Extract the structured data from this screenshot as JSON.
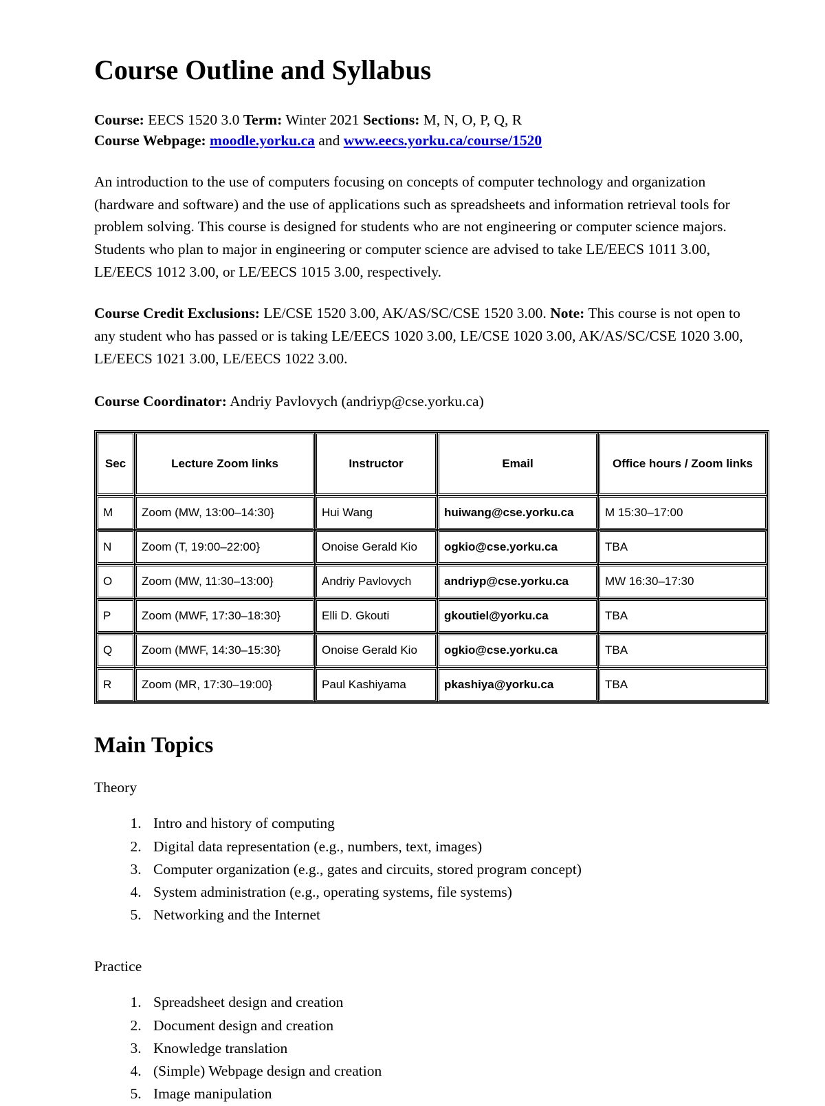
{
  "document": {
    "title": "Course Outline and Syllabus",
    "meta": {
      "course_label": "Course:",
      "course_value": "EECS 1520 3.0",
      "term_label": "Term:",
      "term_value": "Winter 2021",
      "sections_label": "Sections:",
      "sections_value": "M, N, O, P, Q, R",
      "webpage_label": "Course Webpage:",
      "webpage_link1": "moodle.yorku.ca",
      "webpage_conjunction": "and",
      "webpage_link2": "www.eecs.yorku.ca/course/1520",
      "link_color": "#0000cc"
    },
    "description": "An introduction to the use of computers focusing on concepts of computer technology and organization (hardware and software) and the use of applications such as spreadsheets and information retrieval tools for problem solving. This course is designed for students who are not engineering or computer science majors. Students who plan to major in engineering or computer science are advised to take LE/EECS 1011 3.00, LE/EECS 1012 3.00, or LE/EECS 1015 3.00, respectively.",
    "exclusions": {
      "label": "Course Credit Exclusions:",
      "text": "LE/CSE 1520 3.00, AK/AS/SC/CSE 1520 3.00.",
      "note_label": "Note:",
      "note_text": "This course is not open to any student who has passed or is taking LE/EECS 1020 3.00, LE/CSE 1020 3.00, AK/AS/SC/CSE 1020 3.00, LE/EECS 1021 3.00, LE/EECS 1022 3.00."
    },
    "coordinator": {
      "label": "Course Coordinator:",
      "value": "Andriy Pavlovych (andriyp@cse.yorku.ca)"
    }
  },
  "sections_table": {
    "headers": [
      "Sec",
      "Lecture Zoom links",
      "Instructor",
      "Email",
      "Office hours / Zoom links"
    ],
    "rows": [
      {
        "sec": "M",
        "zoom": "Zoom (MW, 13:00–14:30}",
        "instructor": "Hui Wang",
        "email": "huiwang@cse.yorku.ca",
        "office_hours": "M 15:30–17:00"
      },
      {
        "sec": "N",
        "zoom": "Zoom (T, 19:00–22:00}",
        "instructor": "Onoise Gerald Kio",
        "email": "ogkio@cse.yorku.ca",
        "office_hours": "TBA"
      },
      {
        "sec": "O",
        "zoom": "Zoom (MW, 11:30–13:00}",
        "instructor": "Andriy Pavlovych",
        "email": "andriyp@cse.yorku.ca",
        "office_hours": "MW 16:30–17:30"
      },
      {
        "sec": "P",
        "zoom": "Zoom (MWF, 17:30–18:30}",
        "instructor": "Elli D. Gkouti",
        "email": "gkoutiel@yorku.ca",
        "office_hours": "TBA"
      },
      {
        "sec": "Q",
        "zoom": "Zoom (MWF, 14:30–15:30}",
        "instructor": "Onoise Gerald Kio",
        "email": "ogkio@cse.yorku.ca",
        "office_hours": "TBA"
      },
      {
        "sec": "R",
        "zoom": "Zoom (MR, 17:30–19:00}",
        "instructor": "Paul Kashiyama",
        "email": "pkashiya@yorku.ca",
        "office_hours": "TBA"
      }
    ]
  },
  "main_topics": {
    "heading": "Main Topics",
    "theory": {
      "label": "Theory",
      "items": [
        "Intro and history of computing",
        "Digital data representation (e.g., numbers, text, images)",
        "Computer organization (e.g., gates and circuits, stored program concept)",
        "System administration (e.g., operating systems, file systems)",
        "Networking and the Internet"
      ]
    },
    "practice": {
      "label": "Practice",
      "items": [
        "Spreadsheet design and creation",
        "Document design and creation",
        "Knowledge translation",
        "(Simple) Webpage design and creation",
        "Image manipulation"
      ]
    }
  }
}
